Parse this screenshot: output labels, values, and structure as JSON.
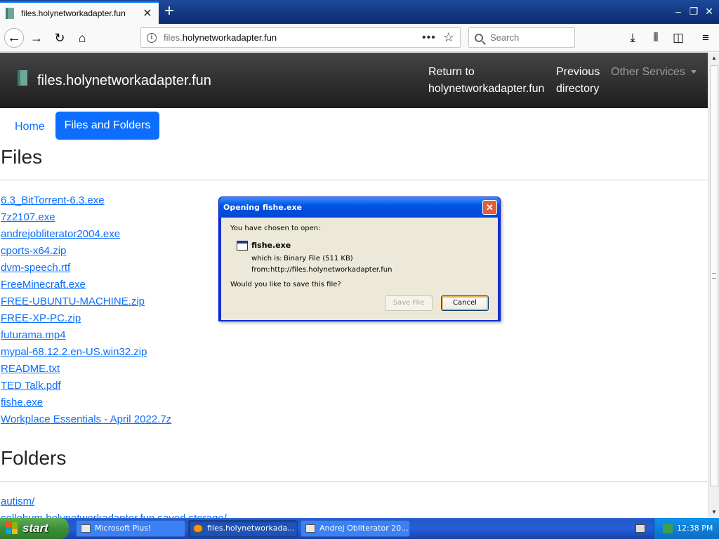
{
  "browser": {
    "tab_title": "files.holynetworkadapter.fun",
    "new_tab": "+",
    "url_host": "files.",
    "url_domain": "holynetworkadapter.fun",
    "url_more": "•••",
    "search_placeholder": "Search",
    "window_minimize": "–",
    "window_restore": "❐",
    "window_close": "✕",
    "tab_close": "✕"
  },
  "site": {
    "brand": "files.holynetworkadapter.fun",
    "header_links": {
      "return_line1": "Return to",
      "return_line2": "holynetworkadapter.fun",
      "previous_line1": "Previous",
      "previous_line2": "directory",
      "other_services": "Other Services"
    },
    "subnav": {
      "home": "Home",
      "files_and_folders": "Files and Folders"
    },
    "files_heading": "Files",
    "files": [
      "6.3_BitTorrent-6.3.exe",
      "7z2107.exe",
      "andrejobliterator2004.exe",
      "cports-x64.zip",
      "dvm-speech.rtf",
      "FreeMinecraft.exe",
      "FREE-UBUNTU-MACHINE.zip",
      "FREE-XP-PC.zip",
      "futurama.mp4",
      "mypal-68.12.2.en-US.win32.zip",
      "README.txt",
      "TED Talk.pdf",
      "fishe.exe",
      "Workplace Essentials - April 2022.7z"
    ],
    "folders_heading": "Folders",
    "folders": [
      "autism/",
      "cellobum.holynetworkadapter.fun saved storage/"
    ]
  },
  "dialog": {
    "title": "Opening fishe.exe",
    "close": "✕",
    "prompt": "You have chosen to open:",
    "filename": "fishe.exe",
    "which_is_label": "which is:",
    "which_is_value": "Binary File (511 KB)",
    "from_label": "from:",
    "from_value": "http://files.holynetworkadapter.fun",
    "question": "Would you like to save this file?",
    "save_button": "Save File",
    "cancel_button": "Cancel"
  },
  "taskbar": {
    "start": "start",
    "tasks": [
      "Microsoft Plus!",
      "files.holynetworkada...",
      "Andrej Obliterator 20..."
    ],
    "clock": "12:38 PM"
  },
  "colors": {
    "link": "#0d6efd",
    "header_bg": "#2b2b2b",
    "xp_blue": "#0055e5"
  }
}
